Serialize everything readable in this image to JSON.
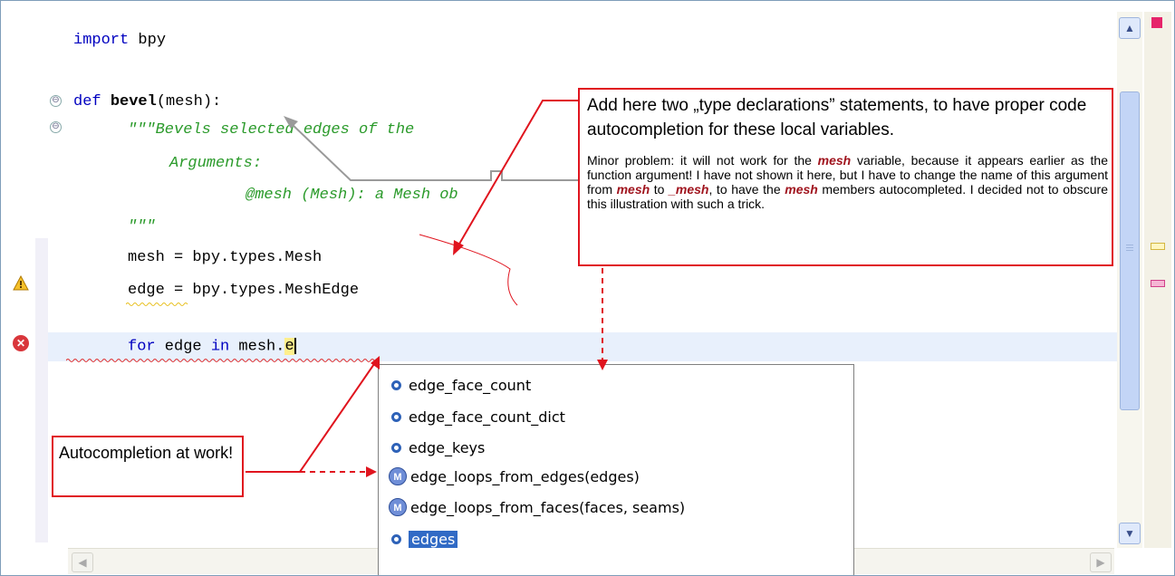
{
  "editor": {
    "lines": {
      "l1_kw": "import",
      "l1_rest": " bpy",
      "l2_kw": "def",
      "l2_name": "bevel",
      "l2_rest": "(mesh):",
      "l3_doc": "\"\"\"Bevels selected edges of the",
      "l4_doc": "Arguments:",
      "l5_doc": "@mesh (Mesh): a Mesh ob",
      "l6_doc": "\"\"\"",
      "l7": "mesh = bpy.types.Mesh",
      "l8": "edge = bpy.types.MeshEdge",
      "l9_kw1": "for",
      "l9_mid": " edge ",
      "l9_kw2": "in",
      "l9_rest": " mesh.",
      "l9_typed": "e"
    },
    "markers": {
      "warning_icon": "warning-icon",
      "error_icon": "error-icon",
      "error_glyph": "✕",
      "fold_glyph": "⊖"
    }
  },
  "autocomplete": {
    "items": [
      {
        "label": "edge_face_count",
        "kind": "field"
      },
      {
        "label": "edge_face_count_dict",
        "kind": "field"
      },
      {
        "label": "edge_keys",
        "kind": "field"
      },
      {
        "label": "edge_loops_from_edges(edges)",
        "kind": "method"
      },
      {
        "label": "edge_loops_from_faces(faces, seams)",
        "kind": "method"
      },
      {
        "label": "edges",
        "kind": "field",
        "selected": true
      }
    ],
    "method_glyph": "M"
  },
  "annotations": {
    "top_title": "Add here two „type declarations” statements, to have proper code autocompletion for these local variables.",
    "top_body_1": "Minor problem: it will not work for the ",
    "top_body_mesh1": "mesh",
    "top_body_2": " variable, because it appears earlier as the function argument! I have not shown it here, but I have to change the name of this argument from ",
    "top_body_mesh2": "mesh",
    "top_body_3": " to ",
    "top_body_mesh3": "_mesh",
    "top_body_4": ", to have the ",
    "top_body_mesh4": "mesh",
    "top_body_5": " members autocompleted. I decided not to obscure this illustration with such a trick.",
    "bottom_text": "Autocompletion at work!"
  },
  "scrollbar": {
    "up_glyph": "▲",
    "down_glyph": "▼",
    "left_glyph": "◀",
    "right_glyph": "▶"
  },
  "colors": {
    "keyword": "#0000c0",
    "docstring": "#2a9a2a",
    "annotation_border": "#e0141e",
    "selection": "#316ac5"
  }
}
